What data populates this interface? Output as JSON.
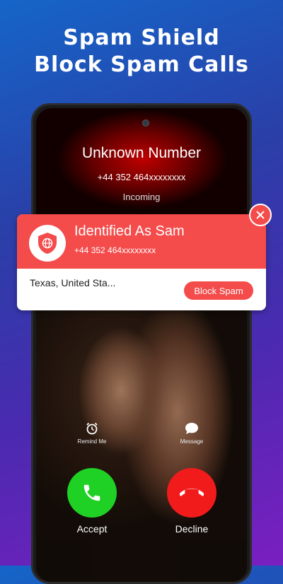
{
  "headline": {
    "line1": "Spam Shield",
    "line2": "Block Spam Calls"
  },
  "call_screen": {
    "caller_name": "Unknown Number",
    "caller_number": "+44 352 464xxxxxxxx",
    "status": "Incoming"
  },
  "spam_card": {
    "title": "Identified As Sam",
    "number": "+44 352 464xxxxxxxx",
    "location": "Texas, United Sta...",
    "block_label": "Block Spam",
    "accent_color": "#f44b4b",
    "icon": "shield-globe-icon"
  },
  "actions": {
    "remind_label": "Remind Me",
    "message_label": "Message",
    "accept_label": "Accept",
    "decline_label": "Decline",
    "accept_color": "#1fd125",
    "decline_color": "#f21b1b"
  }
}
